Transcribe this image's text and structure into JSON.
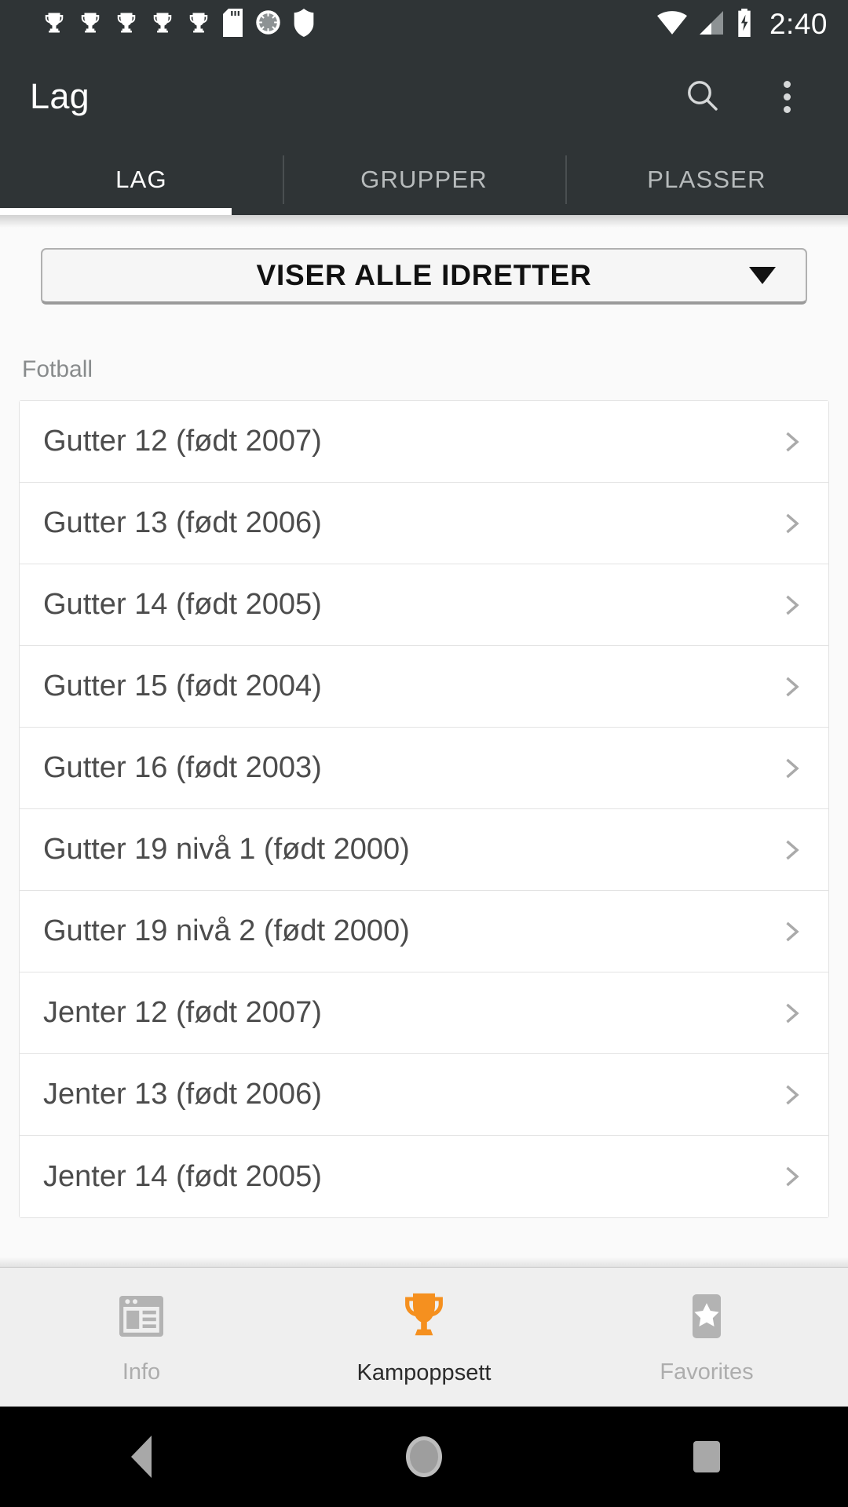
{
  "status_bar": {
    "icons": [
      "trophy-icon",
      "trophy-icon",
      "trophy-icon",
      "trophy-icon",
      "trophy-icon",
      "sd-card-icon",
      "sync-circle-icon",
      "shield-icon"
    ],
    "wifi_icon": "wifi-icon",
    "signal_icon": "cellular-signal-icon",
    "battery_icon": "battery-charging-icon",
    "clock": "2:40"
  },
  "app_bar": {
    "title": "Lag",
    "search_icon": "search-icon",
    "overflow_icon": "overflow-menu-icon"
  },
  "tabs": {
    "items": [
      {
        "label": "LAG",
        "active": true
      },
      {
        "label": "GRUPPER",
        "active": false
      },
      {
        "label": "PLASSER",
        "active": false
      }
    ],
    "active_index": 0
  },
  "sport_filter": {
    "selected": "VISER ALLE IDRETTER",
    "arrow_icon": "chevron-down-icon"
  },
  "teams_list": {
    "section_header": "Fotball",
    "chevron_icon": "chevron-right-icon",
    "items": [
      "Gutter 12 (født 2007)",
      "Gutter 13 (født 2006)",
      "Gutter 14 (født 2005)",
      "Gutter 15 (født 2004)",
      "Gutter 16 (født 2003)",
      "Gutter 19 nivå 1 (født 2000)",
      "Gutter 19 nivå 2 (født 2000)",
      "Jenter 12 (født 2007)",
      "Jenter 13 (født 2006)",
      "Jenter 14 (født 2005)"
    ]
  },
  "bottom_nav": {
    "items": [
      {
        "label": "Info",
        "icon": "news-article-icon",
        "active": false
      },
      {
        "label": "Kampoppsett",
        "icon": "trophy-icon",
        "active": true
      },
      {
        "label": "Favorites",
        "icon": "star-badge-icon",
        "active": false
      }
    ]
  },
  "android_nav": {
    "back": "back-triangle-icon",
    "home": "home-circle-icon",
    "recents": "recents-square-icon"
  },
  "colors": {
    "app_bar": "#2f3436",
    "accent": "#f5901f",
    "inactive_nav": "#b3b3b3",
    "list_text": "#4c4c4c"
  }
}
